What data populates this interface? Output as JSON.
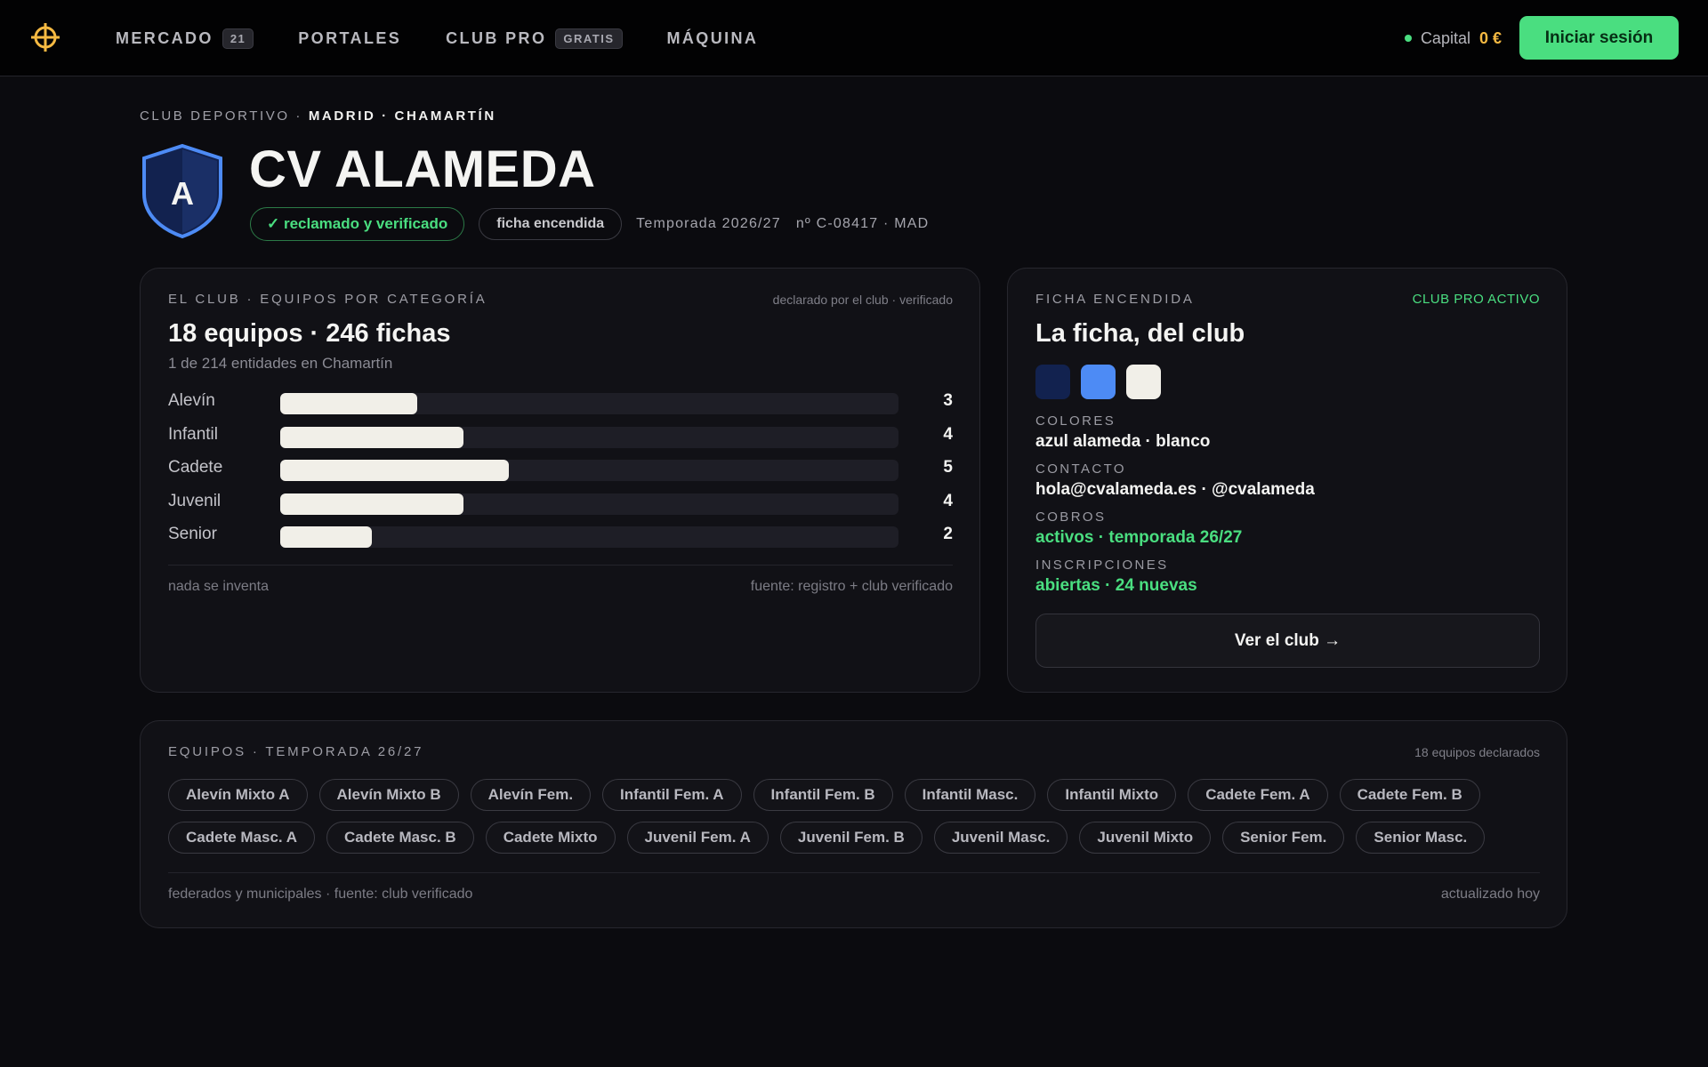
{
  "nav": {
    "items": [
      {
        "label": "MERCADO",
        "badge": "21"
      },
      {
        "label": "PORTALES",
        "badge": ""
      },
      {
        "label": "CLUB PRO",
        "badge": "GRATIS"
      },
      {
        "label": "MÁQUINA",
        "badge": ""
      }
    ],
    "capital_label": "Capital",
    "capital_amount": "0 €",
    "login_label": "Iniciar sesión"
  },
  "header": {
    "kicker": "CLUB DEPORTIVO ·",
    "location": "MADRID · CHAMARTÍN",
    "crest_letter": "A",
    "title": "CV ALAMEDA",
    "verified_badge": "✓ reclamado y verificado",
    "ficha_badge": "ficha encendida",
    "meta": "Temporada 2026/27   nº C-08417 · MAD"
  },
  "club_card": {
    "kicker": "EL CLUB · EQUIPOS POR CATEGORÍA",
    "note": "declarado por el club · verificado",
    "heading": "18 equipos · 246 fichas",
    "sub": "1 de 214 entidades en Chamartín",
    "footer_left": "nada se inventa",
    "footer_right": "fuente: registro + club verificado"
  },
  "chart_data": {
    "type": "bar",
    "orientation": "horizontal",
    "categories": [
      "Alevín",
      "Infantil",
      "Cadete",
      "Juvenil",
      "Senior"
    ],
    "values": [
      3,
      4,
      5,
      4,
      2
    ],
    "xlim": [
      0,
      13.5
    ]
  },
  "ficha_card": {
    "kicker": "FICHA ENCENDIDA",
    "status": "CLUB PRO ACTIVO",
    "heading": "La ficha, del club",
    "swatch_colors": [
      "#12224f",
      "#4d8bf5",
      "#f1efe8"
    ],
    "fields": [
      {
        "label": "COLORES",
        "value": "azul alameda · blanco"
      },
      {
        "label": "CONTACTO",
        "value": "hola@cvalameda.es · @cvalameda"
      },
      {
        "label": "COBROS",
        "value": "activos · temporada 26/27"
      },
      {
        "label": "INSCRIPCIONES",
        "value": "abiertas · 24 nuevas"
      }
    ],
    "button_label": "Ver el club →"
  },
  "teams_card": {
    "kicker": "EQUIPOS · TEMPORADA 26/27",
    "note": "18 equipos declarados",
    "teams": [
      "Alevín Mixto A",
      "Alevín Mixto B",
      "Alevín Fem.",
      "Infantil Fem. A",
      "Infantil Fem. B",
      "Infantil Masc.",
      "Infantil Mixto",
      "Cadete Fem. A",
      "Cadete Fem. B",
      "Cadete Masc. A",
      "Cadete Masc. B",
      "Cadete Mixto",
      "Juvenil Fem. A",
      "Juvenil Fem. B",
      "Juvenil Masc.",
      "Juvenil Mixto",
      "Senior Fem.",
      "Senior Masc."
    ],
    "footer_left": "federados y municipales · fuente: club verificado",
    "footer_right": "actualizado hoy"
  },
  "colors": {
    "accent_green": "#4ade80",
    "accent_gold": "#f5b942",
    "crest_blue": "#4d8bf5",
    "crest_navy": "#12224f"
  }
}
